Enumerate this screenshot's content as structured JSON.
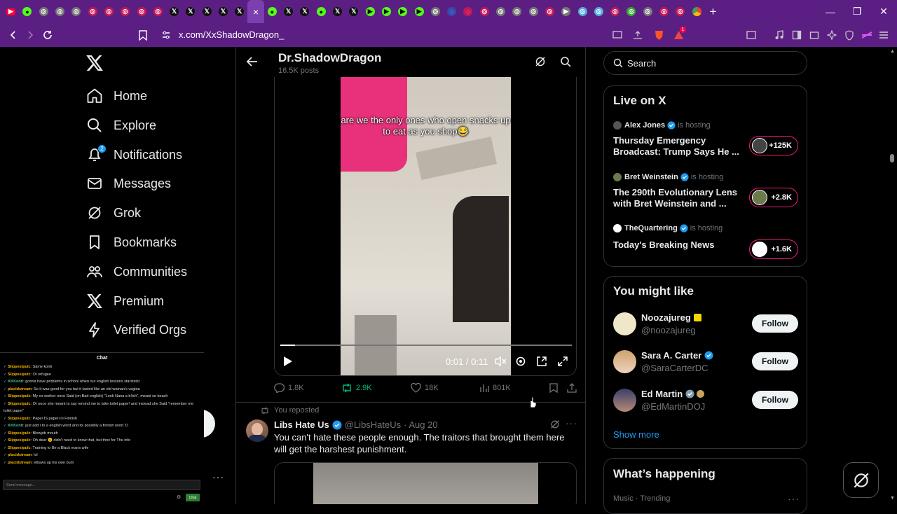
{
  "browser": {
    "url": "x.com/XxShadowDragon_",
    "tab_close": "×",
    "new_tab": "+",
    "notif_count": "1"
  },
  "sidebar": {
    "items": [
      {
        "label": "Home",
        "icon": "home-icon"
      },
      {
        "label": "Explore",
        "icon": "search-icon"
      },
      {
        "label": "Notifications",
        "icon": "bell-icon",
        "badge": "2"
      },
      {
        "label": "Messages",
        "icon": "mail-icon"
      },
      {
        "label": "Grok",
        "icon": "grok-icon"
      },
      {
        "label": "Bookmarks",
        "icon": "bookmark-icon"
      },
      {
        "label": "Communities",
        "icon": "people-icon"
      },
      {
        "label": "Premium",
        "icon": "x-icon"
      },
      {
        "label": "Verified Orgs",
        "icon": "bolt-icon"
      }
    ]
  },
  "chat": {
    "title": "Chat",
    "messages": [
      {
        "user": "Slippeslpulc",
        "text": "Same konti"
      },
      {
        "user": "Slippeslpulc",
        "text": "Or refugee"
      },
      {
        "user": "KKKonti",
        "text": "gonna have problems in school when our english lessons starststst",
        "alt": true
      },
      {
        "user": "placidstream",
        "text": "So it was good for you but it tasted like an old woman's vagina"
      },
      {
        "user": "Slippeslpulc",
        "text": "My co-worker once Said (on Bad english) \"Look Nana a b!tch\", meant se beach"
      },
      {
        "user": "Slippeslpulc",
        "text": "Or once she meant to say remind me to take toilet paper! and instead she Said \"remember me"
      },
      {
        "user": "",
        "text": "toilet paper\""
      },
      {
        "user": "Slippeslpulc",
        "text": "Paper IS paperi in Finnish"
      },
      {
        "user": "KKKonti",
        "text": "just add i to a english word and its possibly a finnish word :D",
        "alt": true
      },
      {
        "user": "Slippeslpulc",
        "text": "Blowjob mouth"
      },
      {
        "user": "Slippeslpulc",
        "text": "Oh dear 😮 didn't need to know that, but thnx for The info"
      },
      {
        "user": "Slippeslpulc",
        "text": "Training to Be a Black mans wife"
      },
      {
        "user": "placidstream",
        "text": "lol"
      },
      {
        "user": "placidstream",
        "text": "elbows up his own bum"
      }
    ],
    "input_placeholder": "Send message...",
    "send_label": "Chat"
  },
  "profile": {
    "name": "Dr.ShadowDragon",
    "posts": "16.5K posts"
  },
  "video": {
    "caption": "are we the only ones who open snacks up to eat as you shop😂",
    "time": "0:01 / 0:11",
    "progress": 0.05
  },
  "tweet1_actions": {
    "replies": "1.8K",
    "reposts": "2.9K",
    "likes": "18K",
    "views": "801K"
  },
  "tweet2": {
    "repost_label": "You reposted",
    "name": "Libs Hate Us",
    "handle": "@LibsHateUs",
    "date": "· Aug 20",
    "text": "You can't hate these people enough. The traitors that brought them here will get the harshest punishment."
  },
  "right": {
    "search_placeholder": "Search",
    "live": {
      "title": "Live on X",
      "items": [
        {
          "host": "Alex Jones",
          "hosting": "is hosting",
          "title": "Thursday Emergency Broadcast: Trump Says He ...",
          "count": "+125K"
        },
        {
          "host": "Bret Weinstein",
          "hosting": "is hosting",
          "title": "The 290th Evolutionary Lens with Bret Weinstein and ...",
          "count": "+2.8K"
        },
        {
          "host": "TheQuartering",
          "hosting": "is hosting",
          "title": "Today's Breaking News",
          "count": "+1.6K"
        }
      ]
    },
    "might_like": {
      "title": "You might like",
      "items": [
        {
          "name": "Noozajureg",
          "handle": "@noozajureg",
          "follow": "Follow"
        },
        {
          "name": "Sara A. Carter",
          "handle": "@SaraCarterDC",
          "follow": "Follow"
        },
        {
          "name": "Ed Martin",
          "handle": "@EdMartinDOJ",
          "follow": "Follow"
        }
      ],
      "show_more": "Show more"
    },
    "happening": {
      "title": "What’s happening",
      "sub": "Music · Trending"
    }
  },
  "colors": {
    "browser_bg": "#5b1f83",
    "accent": "#1d9bf0",
    "repost_green": "#00ba7c",
    "live_pink": "#f91880"
  }
}
